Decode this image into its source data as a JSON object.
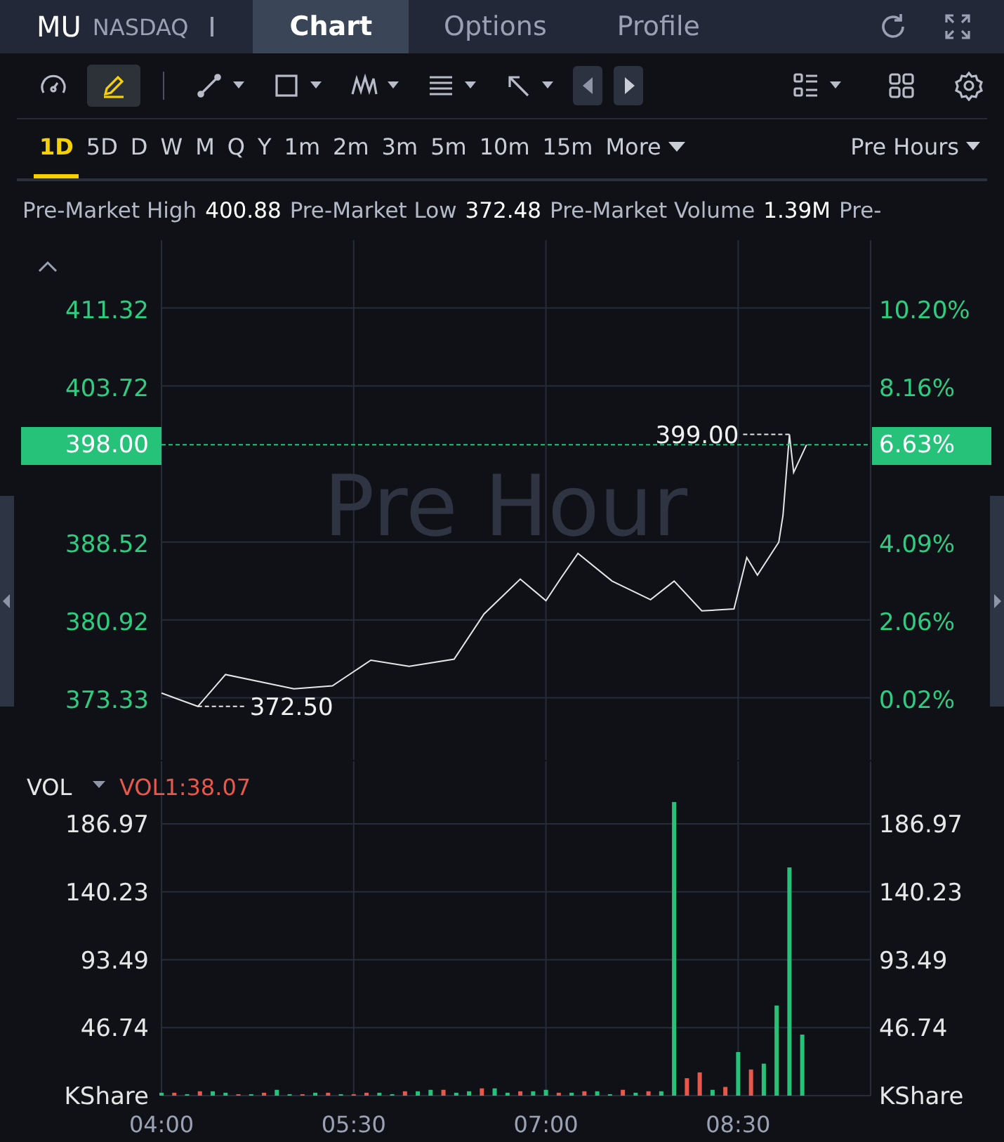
{
  "header": {
    "symbol": "MU",
    "exchange": "NASDAQ",
    "tabs": [
      {
        "label": "Chart",
        "selected": true
      },
      {
        "label": "Options",
        "selected": false
      },
      {
        "label": "Profile",
        "selected": false
      }
    ]
  },
  "toolbar": [
    {
      "kind": "gauge",
      "selected": false,
      "menu": false
    },
    {
      "kind": "pen",
      "selected": true,
      "menu": false
    },
    {
      "kind": "line",
      "selected": false,
      "menu": true
    },
    {
      "kind": "rect",
      "selected": false,
      "menu": true
    },
    {
      "kind": "pattern",
      "selected": false,
      "menu": true
    },
    {
      "kind": "text",
      "selected": false,
      "menu": true
    },
    {
      "kind": "arrow",
      "selected": false,
      "menu": true
    }
  ],
  "periods": [
    {
      "label": "1D",
      "selected": true
    },
    {
      "label": "5D",
      "selected": false
    },
    {
      "label": "D",
      "selected": false
    },
    {
      "label": "W",
      "selected": false
    },
    {
      "label": "M",
      "selected": false
    },
    {
      "label": "Q",
      "selected": false
    },
    {
      "label": "Y",
      "selected": false
    },
    {
      "label": "1m",
      "selected": false
    },
    {
      "label": "2m",
      "selected": false
    },
    {
      "label": "3m",
      "selected": false
    },
    {
      "label": "5m",
      "selected": false
    },
    {
      "label": "10m",
      "selected": false
    },
    {
      "label": "15m",
      "selected": false
    }
  ],
  "more": "More",
  "session": "Pre Hours",
  "stats": [
    {
      "label": "Pre-Market High",
      "value": "400.88"
    },
    {
      "label": "Pre-Market Low",
      "value": "372.48"
    },
    {
      "label": "Pre-Market Volume",
      "value": "1.39M"
    },
    {
      "label": "Pre-"
    }
  ],
  "price_panel": {
    "watermark": "Pre Hour",
    "percent_ticks": [
      "10.20%",
      "8.16%",
      "4.09%",
      "2.06%",
      "0.02%"
    ],
    "high_label": "399.00",
    "low_label": "372.50",
    "last_price": "398.00",
    "last_change": "6.63%",
    "chart_data": {
      "type": "line",
      "grid": true,
      "x": [
        240,
        257,
        270,
        302,
        320,
        338,
        356,
        377,
        391,
        408,
        420,
        427,
        435,
        451,
        469,
        480,
        493,
        508,
        514,
        519,
        529,
        531,
        534,
        536,
        542
      ],
      "series": [
        {
          "color": "#e6e6e6",
          "values": [
            373.8,
            372.5,
            375.6,
            374.2,
            374.5,
            377.0,
            376.4,
            377.1,
            381.5,
            384.9,
            382.8,
            385.0,
            387.4,
            384.7,
            382.9,
            384.7,
            381.8,
            382.0,
            387.0,
            385.3,
            388.5,
            391.1,
            399.0,
            395.3,
            398.0
          ]
        }
      ],
      "xlim": [
        240,
        572
      ],
      "ylim": [
        367.28,
        417.93
      ],
      "yticks": [
        373.33,
        380.92,
        388.52,
        403.72,
        411.32
      ],
      "ref_lines": [
        {
          "axis": "y",
          "value": 398.0,
          "color": "#27c27a"
        }
      ]
    }
  },
  "volume_panel": {
    "title": "VOL",
    "indicator": "VOL1:38.07",
    "right_ticks": [
      "186.97",
      "140.23",
      "93.49",
      "46.74",
      "KShare"
    ],
    "chart_data": {
      "type": "bar",
      "grid": true,
      "x": [
        240,
        246,
        252,
        258,
        264,
        270,
        276,
        282,
        288,
        294,
        300,
        306,
        312,
        318,
        324,
        330,
        336,
        342,
        348,
        354,
        360,
        366,
        372,
        378,
        384,
        390,
        396,
        402,
        408,
        414,
        420,
        426,
        432,
        438,
        444,
        450,
        456,
        462,
        468,
        474,
        480,
        486,
        492,
        498,
        504,
        510,
        516,
        522,
        528,
        534,
        540
      ],
      "series": [
        {
          "color": "#27c27a",
          "values": [
            2,
            null,
            1,
            null,
            3,
            2,
            null,
            1,
            null,
            4,
            1,
            null,
            2,
            null,
            1,
            null,
            null,
            2,
            1,
            null,
            3,
            4,
            null,
            2,
            3,
            null,
            5,
            2,
            null,
            3,
            4,
            null,
            2,
            null,
            3,
            1,
            null,
            2,
            null,
            3,
            202,
            null,
            null,
            4,
            null,
            30,
            null,
            22,
            62,
            157,
            42
          ]
        },
        {
          "color": "#e8584a",
          "values": [
            null,
            2,
            null,
            3,
            null,
            null,
            1,
            null,
            2,
            null,
            null,
            1,
            null,
            2,
            null,
            1,
            2,
            null,
            null,
            3,
            null,
            null,
            4,
            null,
            null,
            5,
            null,
            null,
            3,
            null,
            null,
            2,
            null,
            3,
            null,
            null,
            4,
            null,
            3,
            null,
            null,
            12,
            16,
            null,
            6,
            null,
            18,
            null,
            null,
            null,
            null
          ]
        }
      ],
      "xlim": [
        240,
        572
      ],
      "ylim": [
        0,
        230
      ],
      "xticks": [
        {
          "value": 240,
          "label": "04:00"
        },
        {
          "value": 330,
          "label": "05:30"
        },
        {
          "value": 420,
          "label": "07:00"
        },
        {
          "value": 510,
          "label": "08:30"
        }
      ],
      "yticks": [
        {
          "value": 0,
          "label": "KShare"
        },
        46.74,
        93.49,
        140.23,
        186.97
      ]
    }
  }
}
